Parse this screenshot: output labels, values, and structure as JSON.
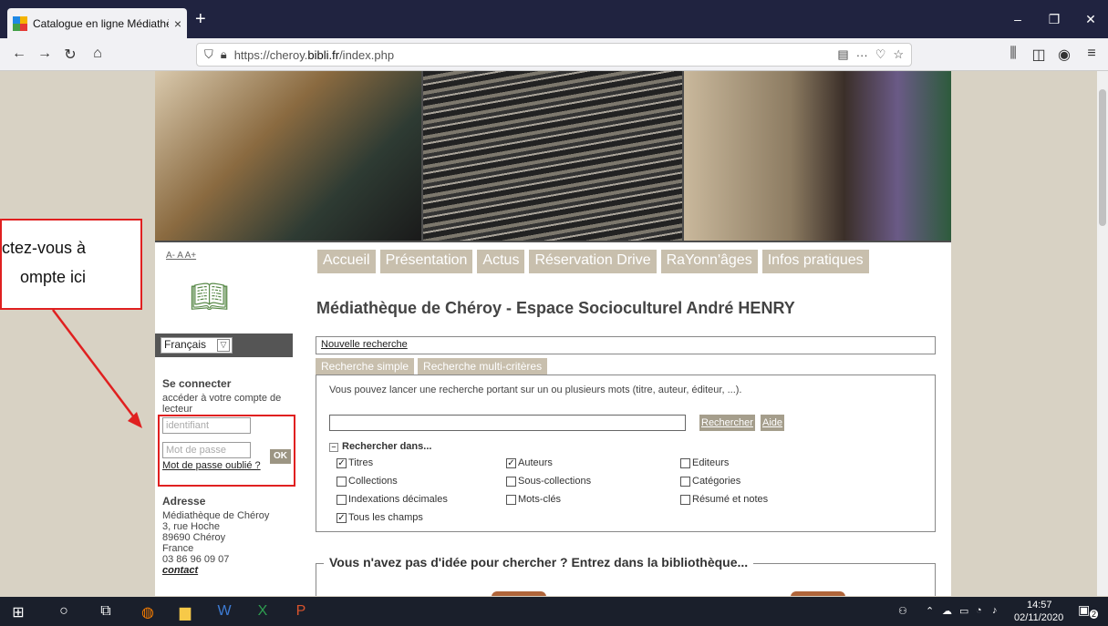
{
  "browser": {
    "tab_title": "Catalogue en ligne Médiathèqu",
    "tab_close": "×",
    "new_tab": "+",
    "url_prefix": "https://cheroy.",
    "url_domain": "bibli.fr",
    "url_path": "/index.php",
    "url_more": "···",
    "controls": {
      "minimize": "–",
      "restore": "❐",
      "close": "✕"
    }
  },
  "site": {
    "font_size_links": "A- A A+",
    "menu": [
      "Accueil",
      "Présentation",
      "Actus",
      "Réservation Drive",
      "RaYonn'âges",
      "Infos pratiques"
    ],
    "title": "Médiathèque de Chéroy - Espace Socioculturel André HENRY",
    "language": "Français",
    "login": {
      "heading": "Se connecter",
      "subtitle": "accéder à votre compte de lecteur",
      "login_placeholder": "identifiant",
      "password_placeholder": "Mot de passe",
      "ok": "OK",
      "forgot": "Mot de passe oublié ?"
    },
    "address": {
      "heading": "Adresse",
      "lines": [
        "Médiathèque de Chéroy",
        "3, rue Hoche",
        "89690 Chéroy",
        "France",
        "03 86 96 09 07"
      ],
      "contact": "contact"
    },
    "search": {
      "new_search": "Nouvelle recherche",
      "tabs": [
        "Recherche simple",
        "Recherche multi-critères"
      ],
      "hint": "Vous pouvez lancer une recherche portant sur un ou plusieurs mots (titre, auteur, éditeur, ...).",
      "search_button": "Rechercher",
      "help_button": "Aide",
      "search_in": "Rechercher dans...",
      "checkboxes": [
        {
          "label": "Titres",
          "checked": true
        },
        {
          "label": "Auteurs",
          "checked": true
        },
        {
          "label": "Editeurs",
          "checked": false
        },
        {
          "label": "Collections",
          "checked": false
        },
        {
          "label": "Sous-collections",
          "checked": false
        },
        {
          "label": "Catégories",
          "checked": false
        },
        {
          "label": "Indexations décimales",
          "checked": false
        },
        {
          "label": "Mots-clés",
          "checked": false
        },
        {
          "label": "Résumé et notes",
          "checked": false
        },
        {
          "label": "Tous les champs",
          "checked": true
        }
      ]
    },
    "idea_heading": "Vous n'avez pas d'idée pour chercher ? Entrez dans la bibliothèque..."
  },
  "annotation": {
    "callout_line1": "ctez-vous à",
    "callout_line2": "ompte ici",
    "color": "#e02020"
  },
  "taskbar": {
    "time": "14:57",
    "date": "02/11/2020",
    "notifications": "2"
  }
}
